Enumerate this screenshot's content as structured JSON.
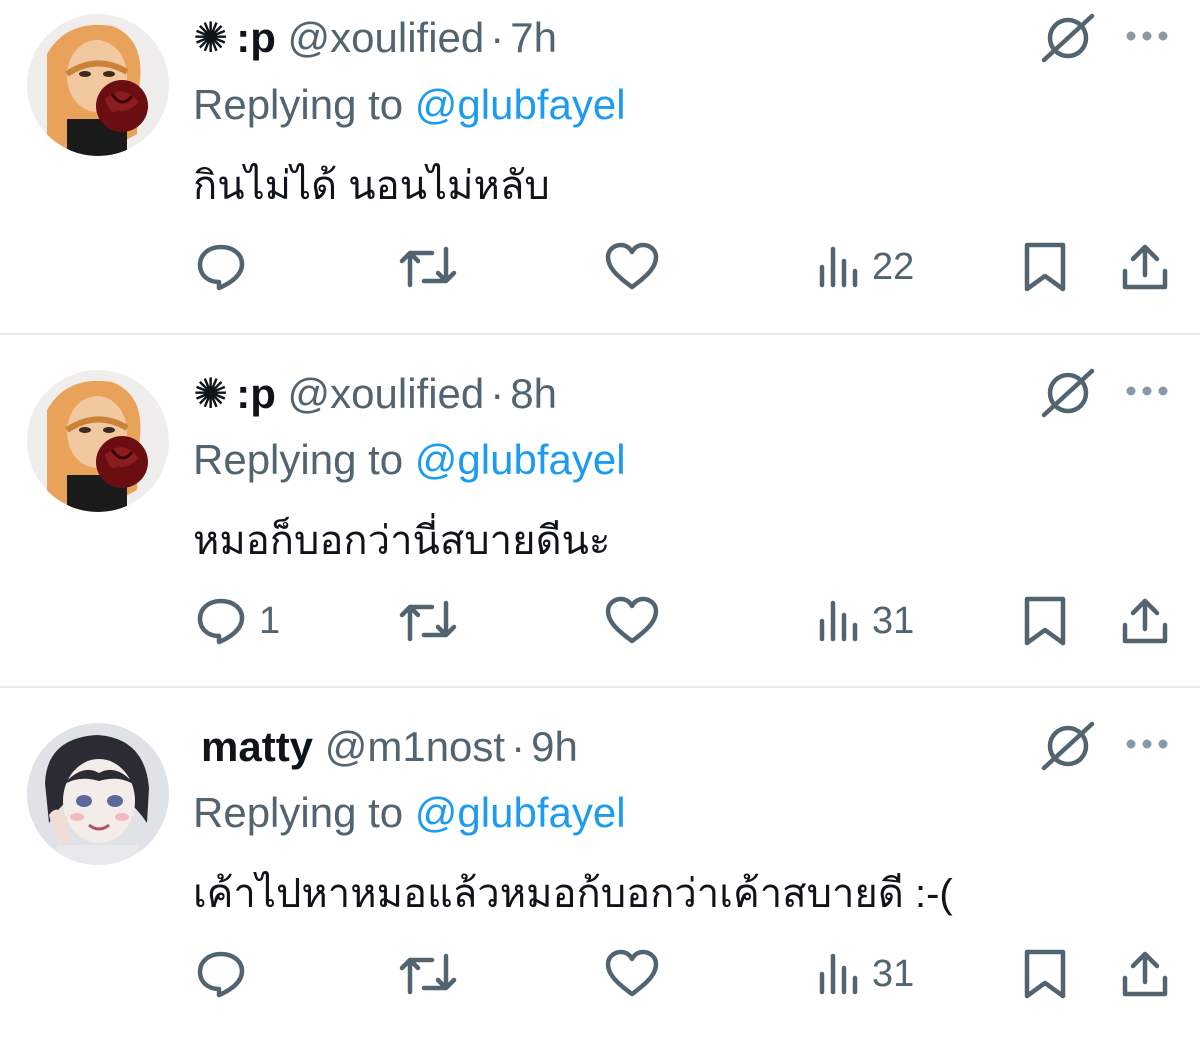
{
  "colors": {
    "text": "#0f1419",
    "secondary": "#536471",
    "link": "#1d9bf0",
    "divider": "#e7e9ec"
  },
  "tweets": [
    {
      "name_icon": "✺",
      "name": ":p",
      "handle": "@xoulified",
      "separator": "·",
      "time": "7h",
      "replying_prefix": "Replying to",
      "replying_to": "@glubfayel",
      "text": "กินไม่ได้ นอนไม่หลับ",
      "reply_count": "",
      "views": "22",
      "avatar": "rose-avatar"
    },
    {
      "name_icon": "✺",
      "name": ":p",
      "handle": "@xoulified",
      "separator": "·",
      "time": "8h",
      "replying_prefix": "Replying to",
      "replying_to": "@glubfayel",
      "text": "หมอก็บอกว่านี่สบายดีนะ",
      "reply_count": "1",
      "views": "31",
      "avatar": "rose-avatar"
    },
    {
      "name_icon": "",
      "name": "matty",
      "handle": "@m1nost",
      "separator": "·",
      "time": "9h",
      "replying_prefix": "Replying to",
      "replying_to": "@glubfayel",
      "text": "เค้าไปหาหมอแล้วหมอก้บอกว่าเค้าสบายดี :-(",
      "reply_count": "",
      "views": "31",
      "avatar": "anime-avatar"
    }
  ]
}
